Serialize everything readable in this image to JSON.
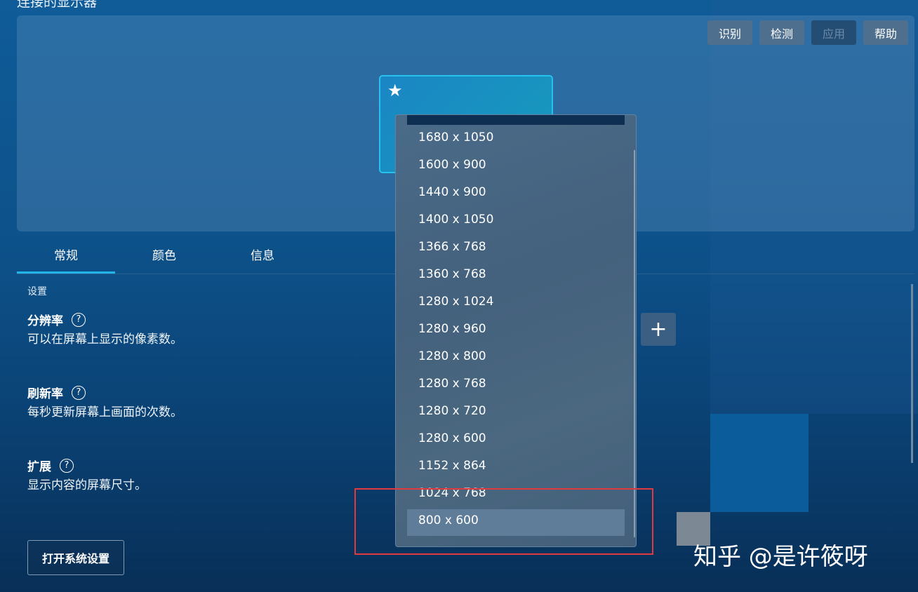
{
  "header": {
    "title": "连接的显示器"
  },
  "toolbar": {
    "identify": "识别",
    "detect": "检测",
    "apply": "应用",
    "help": "帮助"
  },
  "monitor": {
    "primary_icon": "star-icon"
  },
  "tabs": [
    {
      "label": "常规"
    },
    {
      "label": "颜色"
    },
    {
      "label": "信息"
    }
  ],
  "settings": {
    "section_label": "设置",
    "resolution": {
      "title": "分辨率",
      "desc": "可以在屏幕上显示的像素数。"
    },
    "refresh": {
      "title": "刷新率",
      "desc": "每秒更新屏幕上画面的次数。"
    },
    "extend": {
      "title": "扩展",
      "desc": "显示内容的屏幕尺寸。"
    },
    "open_system_settings": "打开系统设置"
  },
  "resolution_dropdown": {
    "options": [
      "1680 x 1050",
      "1600 x 900",
      "1440 x 900",
      "1400 x 1050",
      "1366 x 768",
      "1360 x 768",
      "1280 x 1024",
      "1280 x 960",
      "1280 x 800",
      "1280 x 768",
      "1280 x 720",
      "1280 x 600",
      "1152 x 864",
      "1024 x 768",
      "800 x 600"
    ],
    "highlighted": "800 x 600"
  },
  "add_button_glyph": "+",
  "help_glyph": "?",
  "watermark": "知乎 @是许筱呀",
  "colors": {
    "accent": "#1fb5e8",
    "annotation_box": "#e0393e"
  }
}
